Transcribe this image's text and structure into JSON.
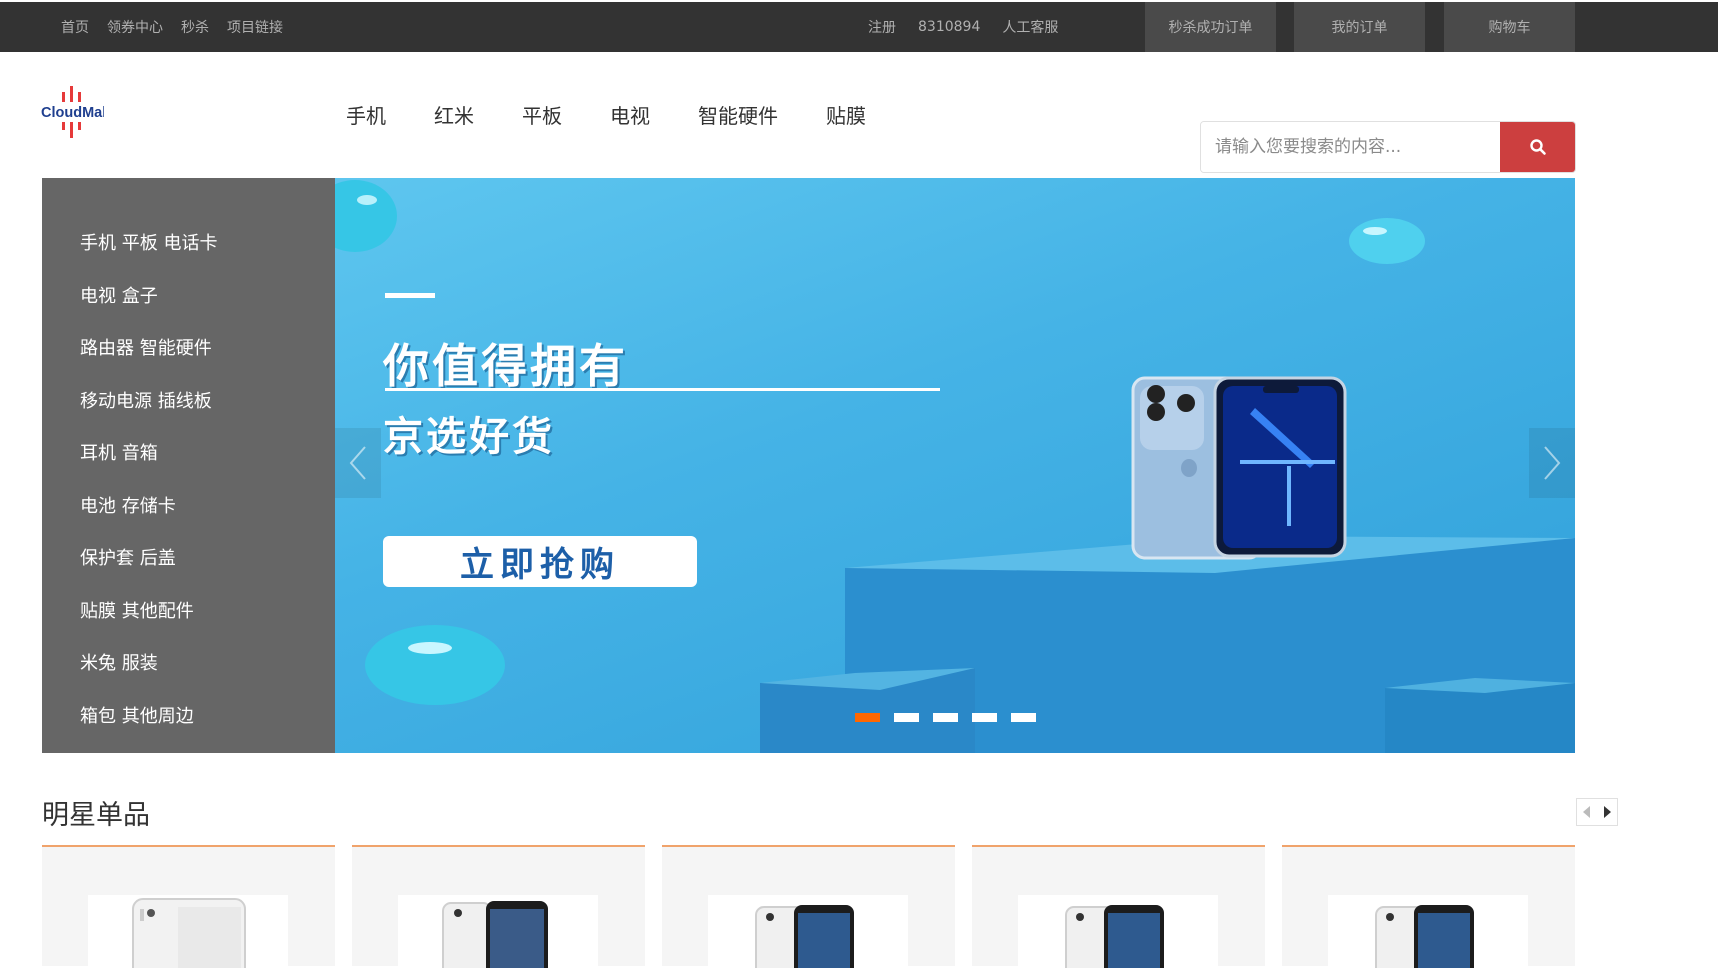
{
  "topbar": {
    "left_links": [
      "首页",
      "领券中心",
      "秒杀",
      "项目链接"
    ],
    "register": "注册",
    "phone": "8310894",
    "service": "人工客服",
    "seckill_orders": "秒杀成功订单",
    "my_orders": "我的订单",
    "cart": "购物车"
  },
  "logo": {
    "text": "CloudMall"
  },
  "nav": {
    "items": [
      "手机",
      "红米",
      "平板",
      "电视",
      "智能硬件",
      "贴膜"
    ]
  },
  "search": {
    "placeholder": "请输入您要搜索的内容..."
  },
  "categories": [
    "手机 平板 电话卡",
    "电视 盒子",
    "路由器 智能硬件",
    "移动电源 插线板",
    "耳机 音箱",
    "电池 存储卡",
    "保护套 后盖",
    "贴膜 其他配件",
    "米兔 服装",
    "箱包 其他周边"
  ],
  "banner": {
    "headline": "你值得拥有",
    "subheadline": "京选好货",
    "cta": "立即抢购",
    "slide_count": 5,
    "active_slide": 1
  },
  "star": {
    "title": "明星单品",
    "card_count": 5
  },
  "colors": {
    "topbar": "#333333",
    "accent": "#ff6700",
    "search_button": "#cc3f3f",
    "sidebar": "#666666"
  }
}
